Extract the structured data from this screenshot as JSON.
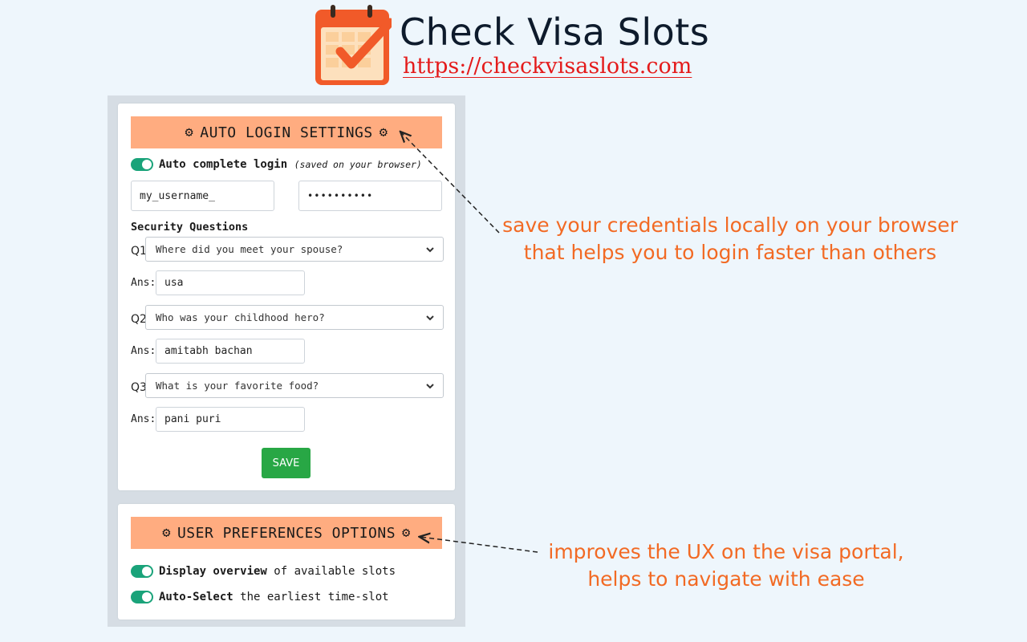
{
  "brand": {
    "title": "Check Visa Slots",
    "url": "https://checkvisaslots.com"
  },
  "colors": {
    "background": "#eef6fc",
    "section_header": "#ffac80",
    "toggle_on": "#1aa37a",
    "save_button": "#28a745",
    "annotation_text": "#f26a24",
    "brand_url": "#e41b1b"
  },
  "auto_login": {
    "header": "AUTO LOGIN SETTINGS",
    "header_icon": "gear-icon",
    "toggle": {
      "on": true,
      "label_bold": "Auto complete login",
      "note": "(saved on your browser)"
    },
    "username": "my_username_",
    "password": "••••••••••",
    "security_title": "Security Questions",
    "answer_label": "Ans:",
    "questions": [
      {
        "label": "Q1",
        "question": "Where did you meet your spouse?",
        "answer": "usa"
      },
      {
        "label": "Q2",
        "question": "Who was your childhood hero?",
        "answer": "amitabh bachan"
      },
      {
        "label": "Q3",
        "question": "What is your favorite food?",
        "answer": "pani puri"
      }
    ],
    "save_label": "SAVE"
  },
  "preferences": {
    "header": "USER PREFERENCES OPTIONS",
    "options": [
      {
        "on": true,
        "bold": "Display overview",
        "rest": " of available slots"
      },
      {
        "on": true,
        "bold": "Auto-Select",
        "rest": " the earliest time-slot"
      }
    ]
  },
  "annotations": {
    "credentials": {
      "line1": "save your credentials locally on your browser",
      "line2": "that helps you to login faster than others"
    },
    "ux": {
      "line1": "improves the UX on the visa portal,",
      "line2": "helps to navigate with ease"
    }
  }
}
